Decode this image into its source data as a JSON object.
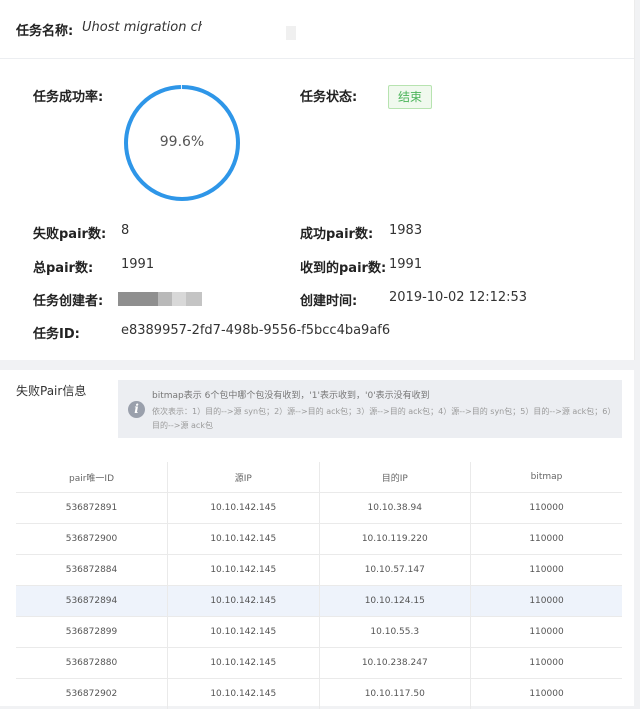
{
  "task": {
    "name_label": "任务名称:",
    "name_value": "Uhost migration check"
  },
  "summary": {
    "success_rate_label": "任务成功率:",
    "success_rate_text": "99.6%",
    "success_rate_value": 0.996,
    "status_label": "任务状态:",
    "status_value": "结束",
    "failed_pairs_label": "失败pair数:",
    "failed_pairs_value": "8",
    "success_pairs_label": "成功pair数:",
    "success_pairs_value": "1983",
    "total_pairs_label": "总pair数:",
    "total_pairs_value": "1991",
    "received_pairs_label": "收到的pair数:",
    "received_pairs_value": "1991",
    "creator_label": "任务创建者:",
    "created_time_label": "创建时间:",
    "created_time_value": "2019-10-02 12:12:53",
    "task_id_label": "任务ID:",
    "task_id_value": "e8389957-2fd7-498b-9556-f5bcc4ba9af6"
  },
  "failed_section": {
    "title": "失败Pair信息",
    "info_line1": "bitmap表示 6个包中哪个包没有收到，'1'表示收到，'0'表示没有收到",
    "info_line2": "依次表示：1）目的-->源 syn包；2）源-->目的 ack包；3）源-->目的 ack包；4）源-->目的 syn包；5）目的-->源 ack包；6）目的-->源 ack包"
  },
  "table": {
    "headers": [
      "pair唯一ID",
      "源IP",
      "目的IP",
      "bitmap"
    ],
    "rows": [
      [
        "536872891",
        "10.10.142.145",
        "10.10.38.94",
        "110000"
      ],
      [
        "536872900",
        "10.10.142.145",
        "10.10.119.220",
        "110000"
      ],
      [
        "536872884",
        "10.10.142.145",
        "10.10.57.147",
        "110000"
      ],
      [
        "536872894",
        "10.10.142.145",
        "10.10.124.15",
        "110000"
      ],
      [
        "536872899",
        "10.10.142.145",
        "10.10.55.3",
        "110000"
      ],
      [
        "536872880",
        "10.10.142.145",
        "10.10.238.247",
        "110000"
      ],
      [
        "536872902",
        "10.10.142.145",
        "10.10.117.50",
        "110000"
      ]
    ]
  },
  "colors": {
    "ring": "#2e96e8",
    "status_green": "#4bb45a",
    "row_highlight": "#eef3fb"
  }
}
